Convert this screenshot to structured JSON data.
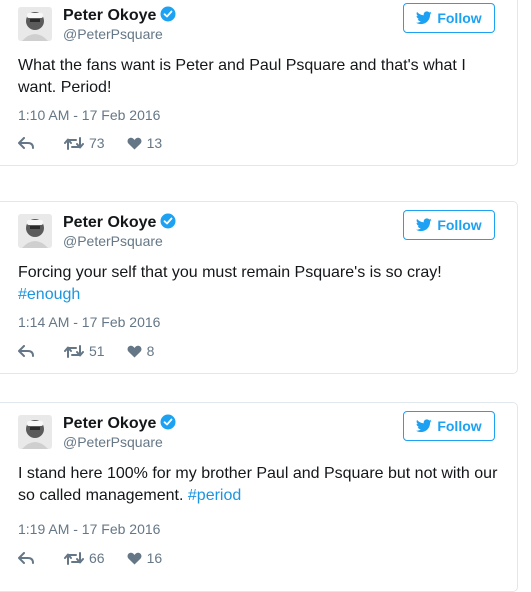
{
  "colors": {
    "twitter_blue": "#1da1f2",
    "link_blue": "#1b95e0",
    "text": "#14171a",
    "muted": "#657786",
    "border": "#e1e8ed"
  },
  "icons": [
    "verified-badge-icon",
    "twitter-bird-icon",
    "reply-icon",
    "retweet-icon",
    "like-heart-icon"
  ],
  "tweets": [
    {
      "author_name": "Peter Okoye",
      "handle": "@PeterPsquare",
      "follow_label": "Follow",
      "text": "What the fans want is Peter and Paul Psquare and that's what I want. Period!",
      "hashtag": "",
      "timestamp": "1:10 AM - 17 Feb 2016",
      "retweets": "73",
      "likes": "13"
    },
    {
      "author_name": "Peter Okoye",
      "handle": "@PeterPsquare",
      "follow_label": "Follow",
      "text": "Forcing your self that you must remain Psquare's is so cray!",
      "hashtag": "#enough",
      "timestamp": "1:14 AM - 17 Feb 2016",
      "retweets": "51",
      "likes": "8"
    },
    {
      "author_name": "Peter Okoye",
      "handle": "@PeterPsquare",
      "follow_label": "Follow",
      "text": "I stand here 100% for my brother Paul and Psquare but not with our so called management.",
      "hashtag": "#period",
      "timestamp": "1:19 AM - 17 Feb 2016",
      "retweets": "66",
      "likes": "16"
    }
  ]
}
